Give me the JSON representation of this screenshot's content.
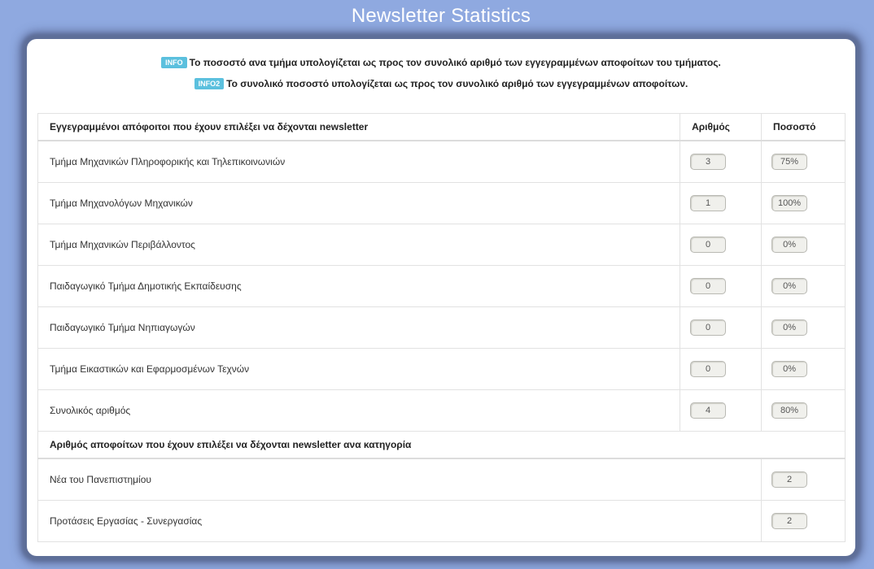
{
  "page": {
    "title": "Newsletter Statistics"
  },
  "info": [
    {
      "badge": "INFO",
      "text": "Το ποσοστό ανα τμήμα υπολογίζεται ως προς τον συνολικό αριθμό των εγγεγραμμένων αποφοίτων του τμήματος."
    },
    {
      "badge": "INFO2",
      "text": "Το συνολικό ποσοστό υπολογίζεται ως προς τον συνολικό αριθμό των εγγεγραμμένων αποφοίτων."
    }
  ],
  "table": {
    "headers": [
      "Εγγεγραμμένοι απόφοιτοι που έχουν επιλέξει να δέχονται newsletter",
      "Αριθμός",
      "Ποσοστό"
    ],
    "rows": [
      {
        "label": "Τμήμα Μηχανικών Πληροφορικής και Τηλεπικοινωνιών",
        "count": "3",
        "percent": "75%"
      },
      {
        "label": "Τμήμα Μηχανολόγων Μηχανικών",
        "count": "1",
        "percent": "100%"
      },
      {
        "label": "Τμήμα Μηχανικών Περιβάλλοντος",
        "count": "0",
        "percent": "0%"
      },
      {
        "label": "Παιδαγωγικό Τμήμα Δημοτικής Εκπαίδευσης",
        "count": "0",
        "percent": "0%"
      },
      {
        "label": "Παιδαγωγικό Τμήμα Νηπιαγωγών",
        "count": "0",
        "percent": "0%"
      },
      {
        "label": "Τμήμα Εικαστικών και Εφαρμοσμένων Τεχνών",
        "count": "0",
        "percent": "0%"
      },
      {
        "label": "Συνολικός αριθμός",
        "count": "4",
        "percent": "80%"
      }
    ],
    "category_header": "Αριθμός αποφοίτων που έχουν επιλέξει να δέχονται newsletter ανα κατηγορία",
    "categories": [
      {
        "label": "Νέα του Πανεπιστημίου",
        "count": "2"
      },
      {
        "label": "Προτάσεις Εργασίας - Συνεργασίας",
        "count": "2"
      }
    ]
  }
}
